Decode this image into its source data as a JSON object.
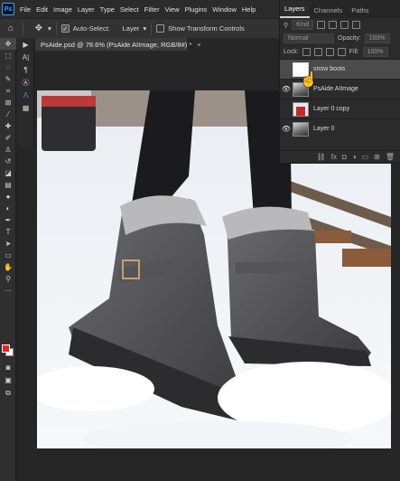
{
  "menubar": {
    "logo": "Ps",
    "items": [
      "File",
      "Edit",
      "Image",
      "Layer",
      "Type",
      "Select",
      "Filter",
      "View",
      "Plugins",
      "Window",
      "Help"
    ]
  },
  "options": {
    "auto_select_label": "Auto-Select:",
    "auto_select_target": "Layer",
    "transform_label": "Show Transform Controls"
  },
  "document": {
    "tab_title": "PsAide.psd @ 78.6% (PsAide AIImage, RGB/8#) *",
    "tab_close": "×"
  },
  "colors": {
    "foreground": "#e8241c",
    "background": "#ffffff",
    "accent": "#31a8ff"
  },
  "layers_panel": {
    "tabs": [
      "Layers",
      "Channels",
      "Paths"
    ],
    "filter_kind": "Kind",
    "blend_mode": "Normal",
    "opacity_label": "Opacity:",
    "opacity_value": "100%",
    "lock_label": "Lock:",
    "fill_label": "Fill:",
    "fill_value": "100%",
    "layers": [
      {
        "name": "snow boots",
        "visible": false,
        "selected": true,
        "thumb": "white"
      },
      {
        "name": "PsAide AIImage",
        "visible": true,
        "selected": false,
        "thumb": "photo"
      },
      {
        "name": "Layer 0 copy",
        "visible": false,
        "selected": false,
        "thumb": "red"
      },
      {
        "name": "Layer 0",
        "visible": true,
        "selected": false,
        "thumb": "photo"
      }
    ]
  }
}
